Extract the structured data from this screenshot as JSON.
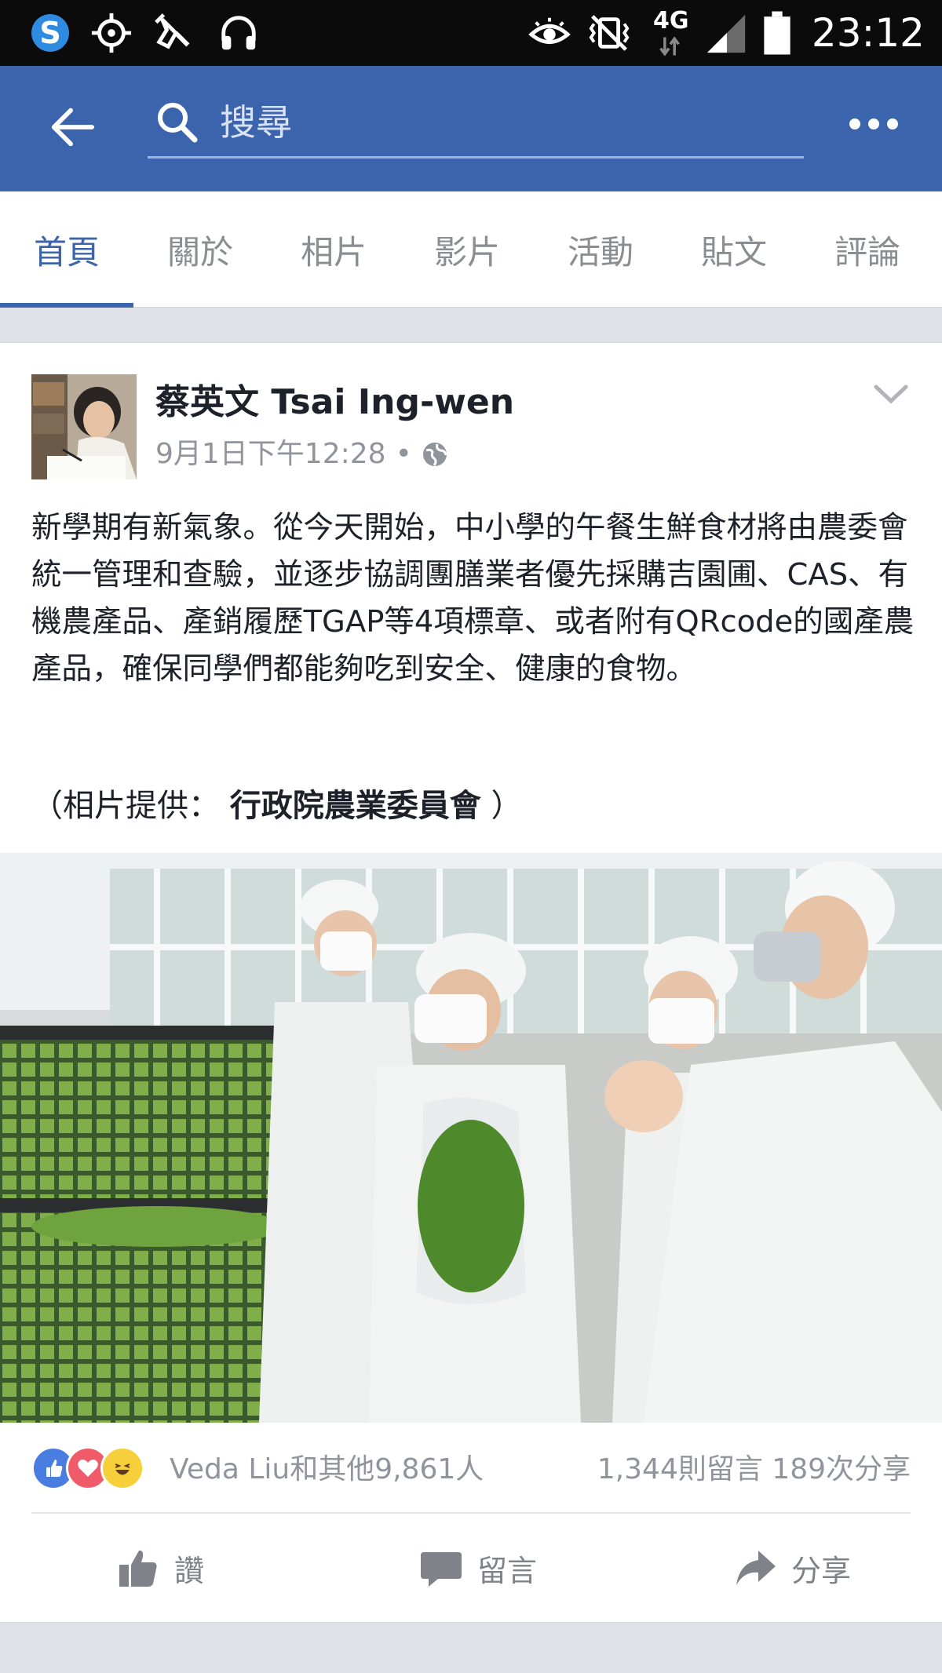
{
  "status_bar": {
    "time": "23:12",
    "network": "4G",
    "icons": [
      "s-app-icon",
      "location-icon",
      "clean-icon",
      "headphones-icon",
      "eye-icon",
      "vibrate-icon",
      "signal-icon",
      "battery-icon"
    ]
  },
  "search": {
    "placeholder": "搜尋"
  },
  "tabs": [
    {
      "label": "首頁",
      "active": true
    },
    {
      "label": "關於",
      "active": false
    },
    {
      "label": "相片",
      "active": false
    },
    {
      "label": "影片",
      "active": false
    },
    {
      "label": "活動",
      "active": false
    },
    {
      "label": "貼文",
      "active": false
    },
    {
      "label": "評論",
      "active": false
    }
  ],
  "post": {
    "author": "蔡英文 Tsai Ing-wen",
    "timestamp": "9月1日下午12:28",
    "separator": "•",
    "body": "新學期有新氣象。從今天開始，中小學的午餐生鮮食材將由農委會統一管理和查驗，並逐步協調團膳業者優先採購吉園圃、CAS、有機農產品、產銷履歷TGAP等4項標章、或者附有QRcode的國產農產品，確保同學們都能夠吃到安全、健康的食物。",
    "credit_prefix": "（相片提供：",
    "credit_source": "行政院農業委員會",
    "credit_suffix": "）",
    "reactions_text": "Veda Liu和其他9,861人",
    "comments_shares": "1,344則留言 189次分享",
    "actions": {
      "like": "讚",
      "comment": "留言",
      "share": "分享"
    }
  },
  "colors": {
    "brand": "#3b64ad",
    "status_bar": "#0b0b0b",
    "muted_text": "#90949c"
  }
}
